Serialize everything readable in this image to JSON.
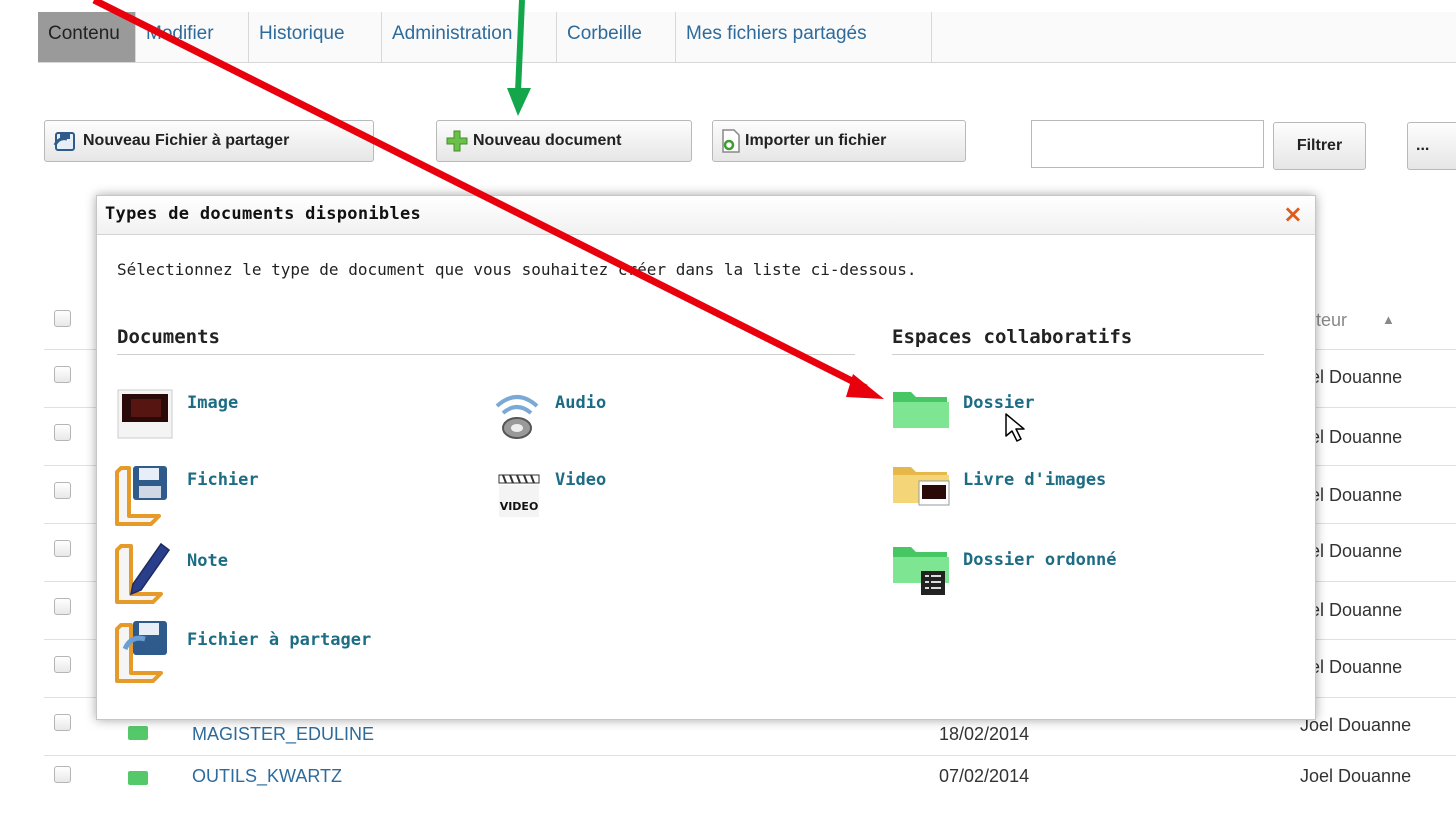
{
  "tabs": [
    "Contenu",
    "Modifier",
    "Historique",
    "Administration",
    "Corbeille",
    "Mes fichiers partagés"
  ],
  "toolbar": {
    "new_shared_file": "Nouveau Fichier à partager",
    "new_document": "Nouveau document",
    "import_file": "Importer un fichier",
    "filter": "Filtrer",
    "more": "..."
  },
  "table": {
    "author_header": "uteur",
    "sort_arrow": "▲",
    "author_values": [
      "bel Douanne",
      "bel Douanne",
      "bel Douanne",
      "bel Douanne",
      "bel Douanne",
      "bel Douanne",
      "Joel Douanne",
      "Joel Douanne"
    ],
    "partial_row": {
      "name": "MAGISTER_EDULINE",
      "date": "18/02/2014"
    },
    "last_row": {
      "name": "OUTILS_KWARTZ",
      "date": "07/02/2014"
    }
  },
  "modal": {
    "title": "Types de documents disponibles",
    "close": "×",
    "description": "Sélectionnez le type de document que vous souhaitez créer dans la liste ci-dessous.",
    "documents_title": "Documents",
    "collab_title": "Espaces collaboratifs",
    "documents": {
      "image": "Image",
      "audio": "Audio",
      "fichier": "Fichier",
      "video": "Video",
      "note": "Note",
      "fichier_partager": "Fichier à partager",
      "video_icon_text": "VIDEO"
    },
    "collab": {
      "dossier": "Dossier",
      "livre": "Livre d'images",
      "ordonne": "Dossier ordonné"
    }
  },
  "colors": {
    "tab_text": "#2d6b9c",
    "item_text": "#1d6c85",
    "close": "#e05a1c",
    "red_arrow": "#e8000d",
    "green_arrow": "#13a64a"
  }
}
